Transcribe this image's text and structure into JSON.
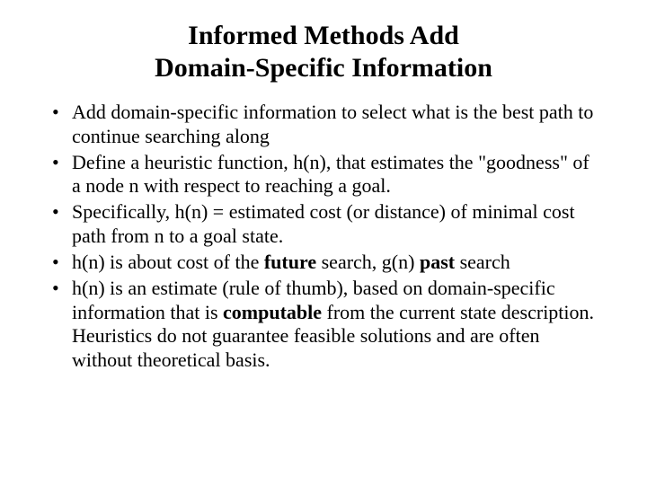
{
  "title_line1": "Informed Methods Add",
  "title_line2": "Domain-Specific Information",
  "bullets": {
    "b0": "Add domain-specific information to select what is the best path to continue searching along",
    "b1": "Define a heuristic function, h(n), that estimates the \"goodness\" of a node n with respect to reaching a goal.",
    "b2": "Specifically, h(n) = estimated cost (or distance) of minimal cost path from n to a goal state.",
    "b3_pre": "h(n) is about cost of the ",
    "b3_bold1": "future",
    "b3_mid": " search, g(n) ",
    "b3_bold2": "past",
    "b3_post": " search",
    "b4_pre": "h(n) is an estimate (rule of thumb), based on domain-specific information that is ",
    "b4_bold": "computable",
    "b4_post": " from the current state description. Heuristics do not guarantee feasible solutions and are often without theoretical basis."
  }
}
